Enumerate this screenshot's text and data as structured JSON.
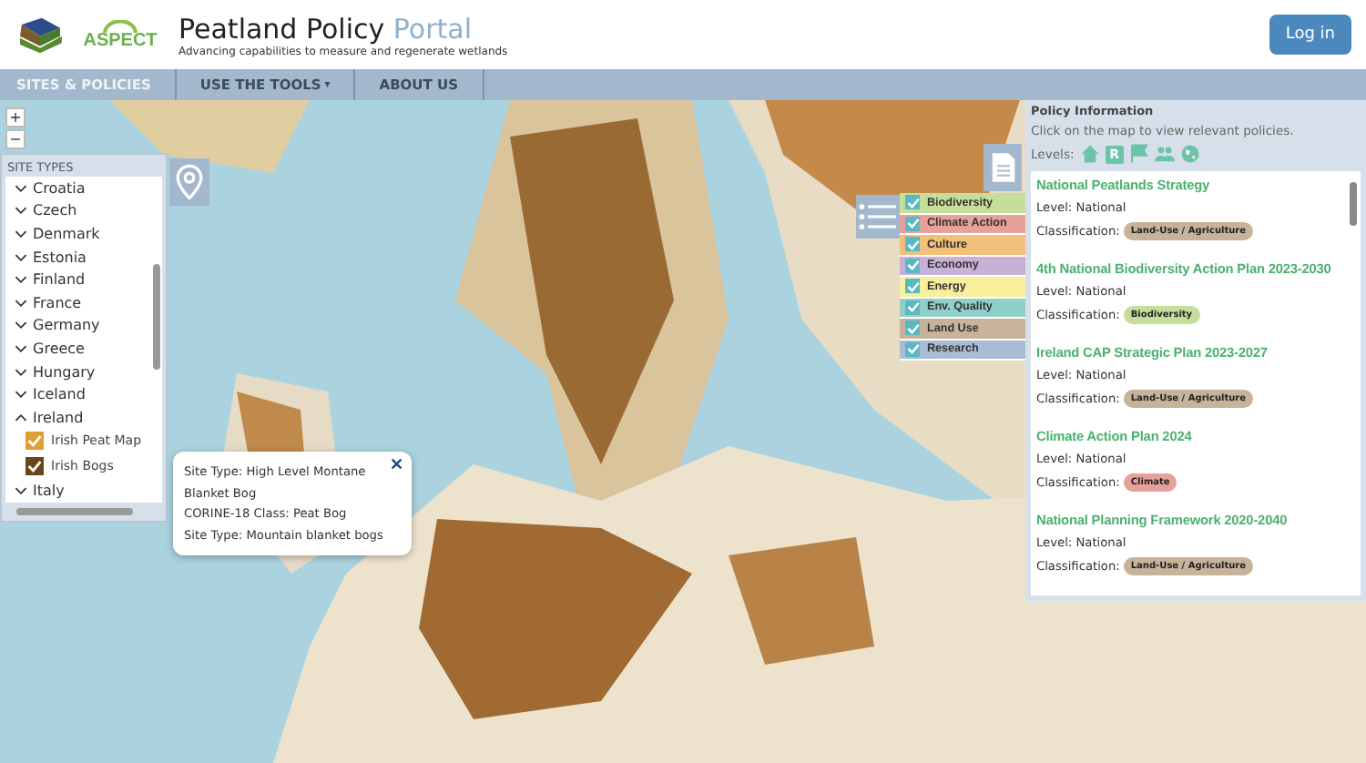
{
  "header": {
    "logo_text": "ASPECT",
    "title": "Peatland Policy",
    "title_accent": "Portal",
    "subtitle": "Advancing capabilities to measure and regenerate wetlands",
    "login": "Log in"
  },
  "nav": [
    {
      "label": "SITES & POLICIES",
      "selected": true
    },
    {
      "label": "USE THE TOOLS",
      "selected": false,
      "caret": "▾"
    },
    {
      "label": "ABOUT US",
      "selected": false
    }
  ],
  "zoom": [
    "+",
    "−"
  ],
  "site_types": {
    "title": "SITE TYPES",
    "items": [
      {
        "label": "Croatia",
        "expanded": false
      },
      {
        "label": "Czech",
        "expanded": false
      },
      {
        "label": "Denmark",
        "expanded": false
      },
      {
        "label": "Estonia",
        "expanded": false
      },
      {
        "label": "Finland",
        "expanded": false
      },
      {
        "label": "France",
        "expanded": false
      },
      {
        "label": "Germany",
        "expanded": false
      },
      {
        "label": "Greece",
        "expanded": false
      },
      {
        "label": "Hungary",
        "expanded": false
      },
      {
        "label": "Iceland",
        "expanded": false
      },
      {
        "label": "Ireland",
        "expanded": true,
        "children": [
          {
            "label": "Irish Peat Map",
            "checked": true,
            "color": "#e0a030"
          },
          {
            "label": "Irish Bogs",
            "checked": true,
            "color": "#6b4419"
          }
        ]
      },
      {
        "label": "Italy",
        "expanded": false
      }
    ]
  },
  "legend": [
    {
      "label": "Biodiversity",
      "checked": true,
      "color": "#c5df9a"
    },
    {
      "label": "Climate Action",
      "checked": true,
      "color": "#e8a09a"
    },
    {
      "label": "Culture",
      "checked": true,
      "color": "#f2c07a"
    },
    {
      "label": "Economy",
      "checked": true,
      "color": "#c9b0d6"
    },
    {
      "label": "Energy",
      "checked": true,
      "color": "#f7ef9c"
    },
    {
      "label": "Env. Quality",
      "checked": true,
      "color": "#8fd0c8"
    },
    {
      "label": "Land Use",
      "checked": true,
      "color": "#c7b29a"
    },
    {
      "label": "Research",
      "checked": true,
      "color": "#a8bcd4"
    }
  ],
  "popup": {
    "lines": [
      "Site Type: High Level Montane Blanket Bog",
      "CORINE-18 Class: Peat Bog",
      "Site Type: Mountain blanket bogs"
    ],
    "close": "✕"
  },
  "policy_panel": {
    "title": "Policy Information",
    "hint": "Click on the map to view relevant policies.",
    "levels_label": "Levels:",
    "level_letter": "R",
    "policies": [
      {
        "name": "National Peatlands Strategy",
        "level": "Level: National",
        "classification_label": "Classification:",
        "tag": {
          "label": "Land-Use / Agriculture",
          "color": "#c7b29a"
        }
      },
      {
        "name": "4th National Biodiversity Action Plan 2023-2030",
        "level": "Level: National",
        "classification_label": "Classification:",
        "tag": {
          "label": "Biodiversity",
          "color": "#c5df9a"
        }
      },
      {
        "name": "Ireland CAP Strategic Plan 2023-2027",
        "level": "Level: National",
        "classification_label": "Classification:",
        "tag": {
          "label": "Land-Use / Agriculture",
          "color": "#c7b29a"
        }
      },
      {
        "name": "Climate Action Plan 2024",
        "level": "Level: National",
        "classification_label": "Classification:",
        "tag": {
          "label": "Climate",
          "color": "#e8a09a"
        }
      },
      {
        "name": "National Planning Framework 2020-2040",
        "level": "Level: National",
        "classification_label": "Classification:",
        "tag": {
          "label": "Land-Use / Agriculture",
          "color": "#c7b29a"
        }
      }
    ]
  }
}
